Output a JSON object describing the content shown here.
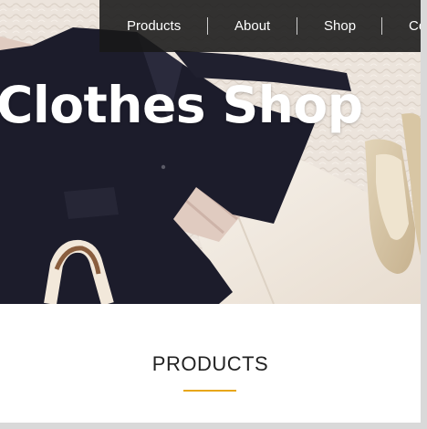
{
  "hero": {
    "title": "Clothes Shop",
    "image": "flat-lay-clothes-photo"
  },
  "nav": {
    "items": [
      {
        "label": "Products"
      },
      {
        "label": "About"
      },
      {
        "label": "Shop"
      },
      {
        "label": "Co"
      }
    ]
  },
  "products_section": {
    "title": "PRODUCTS"
  },
  "colors": {
    "nav_background": "#181818",
    "accent_underline": "#e8a71b",
    "hero_text": "#ffffff",
    "page_background": "#ffffff"
  }
}
